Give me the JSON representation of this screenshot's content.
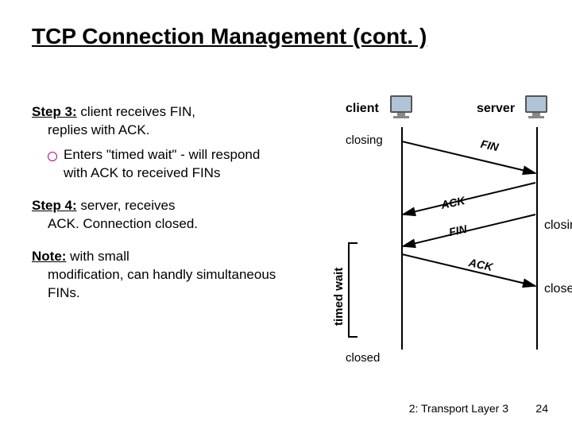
{
  "title": "TCP Connection Management (cont. )",
  "left": {
    "step3": {
      "head": "Step 3:",
      "body1": " client receives FIN,",
      "body2": "replies with ACK.",
      "bullet": "Enters \"timed wait\" - will respond with ACK to received FINs"
    },
    "step4": {
      "head": "Step 4:",
      "body1": " server, receives",
      "body2": "ACK.  Connection closed."
    },
    "note": {
      "head": "Note:",
      "body1": " with small",
      "body2": "modification, can handly simultaneous FINs."
    }
  },
  "diagram": {
    "client": "client",
    "server": "server",
    "closing": "closing",
    "closed": "closed",
    "timedwait": "timed wait",
    "messages": {
      "fin1": "FIN",
      "ack1": "ACK",
      "fin2": "FIN",
      "ack2": "ACK"
    }
  },
  "footer": {
    "chapter": "2: Transport Layer 3",
    "page": "24"
  }
}
